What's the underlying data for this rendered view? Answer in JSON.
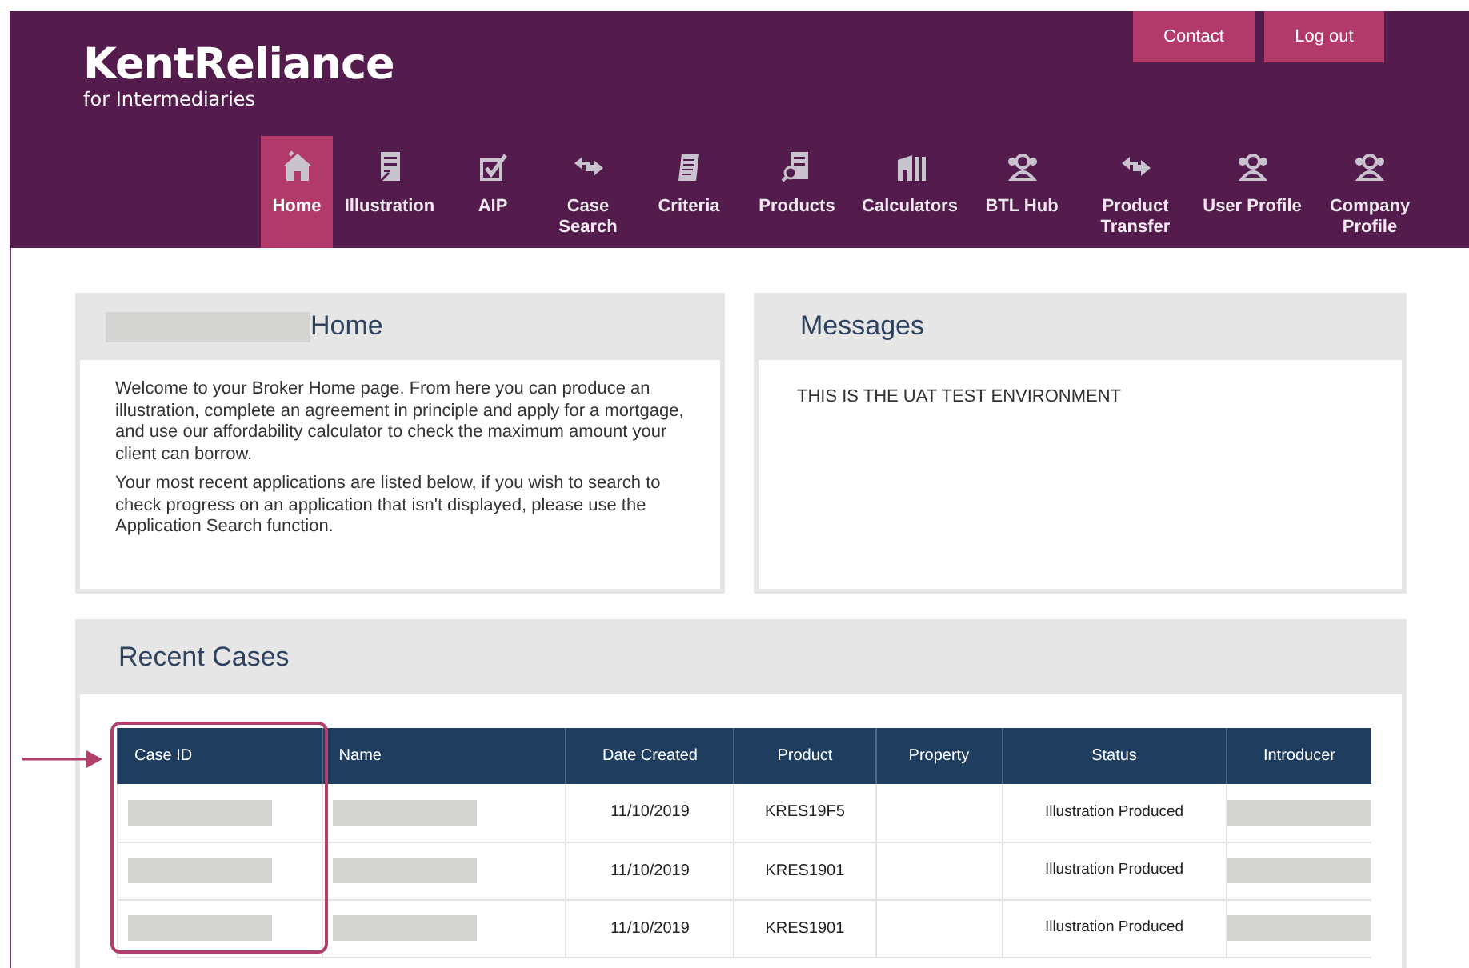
{
  "logo": {
    "name": "KentReliance",
    "tagline": "for Intermediaries"
  },
  "header_buttons": [
    "Contact",
    "Log out"
  ],
  "nav": [
    {
      "label": "Home",
      "selected": true
    },
    {
      "label": "Illustration",
      "selected": false
    },
    {
      "label": "AIP",
      "selected": false
    },
    {
      "label": "Case Search",
      "selected": false
    },
    {
      "label": "Criteria",
      "selected": false
    },
    {
      "label": "Products",
      "selected": false
    },
    {
      "label": "Calculators",
      "selected": false
    },
    {
      "label": "BTL Hub",
      "selected": false
    },
    {
      "label": "Product Transfer",
      "selected": false
    },
    {
      "label": "User Profile",
      "selected": false
    },
    {
      "label": "Company Profile",
      "selected": false
    }
  ],
  "home_panel": {
    "title": "Home",
    "paragraphs": [
      "Welcome to your Broker Home page. From here you can produce an illustration, complete an agreement in principle and apply for a mortgage, and use our affordability calculator to check the maximum amount your client can borrow.",
      "Your most recent applications are listed below, if you wish to search to check progress on an application that isn't displayed, please use the Application Search function."
    ]
  },
  "messages_panel": {
    "title": "Messages",
    "text": "THIS IS THE UAT TEST ENVIRONMENT"
  },
  "recent_cases": {
    "title": "Recent Cases",
    "columns": [
      {
        "label": "Case ID",
        "kind": "redacted",
        "highlighted": true
      },
      {
        "label": "Name",
        "kind": "redacted",
        "highlighted": false
      },
      {
        "label": "Date Created",
        "kind": "date_created",
        "highlighted": false
      },
      {
        "label": "Product",
        "kind": "product",
        "highlighted": false
      },
      {
        "label": "Property",
        "kind": "property",
        "highlighted": false
      },
      {
        "label": "Status",
        "kind": "status",
        "highlighted": false
      },
      {
        "label": "Introducer",
        "kind": "redacted",
        "highlighted": false
      }
    ],
    "rows": [
      {
        "date_created": "11/10/2019",
        "product": "KRES19F5",
        "status": "Illustration Produced"
      },
      {
        "date_created": "11/10/2019",
        "product": "KRES1901",
        "status": "Illustration Produced"
      },
      {
        "date_created": "11/10/2019",
        "product": "KRES1901",
        "status": "Illustration Produced"
      }
    ]
  }
}
